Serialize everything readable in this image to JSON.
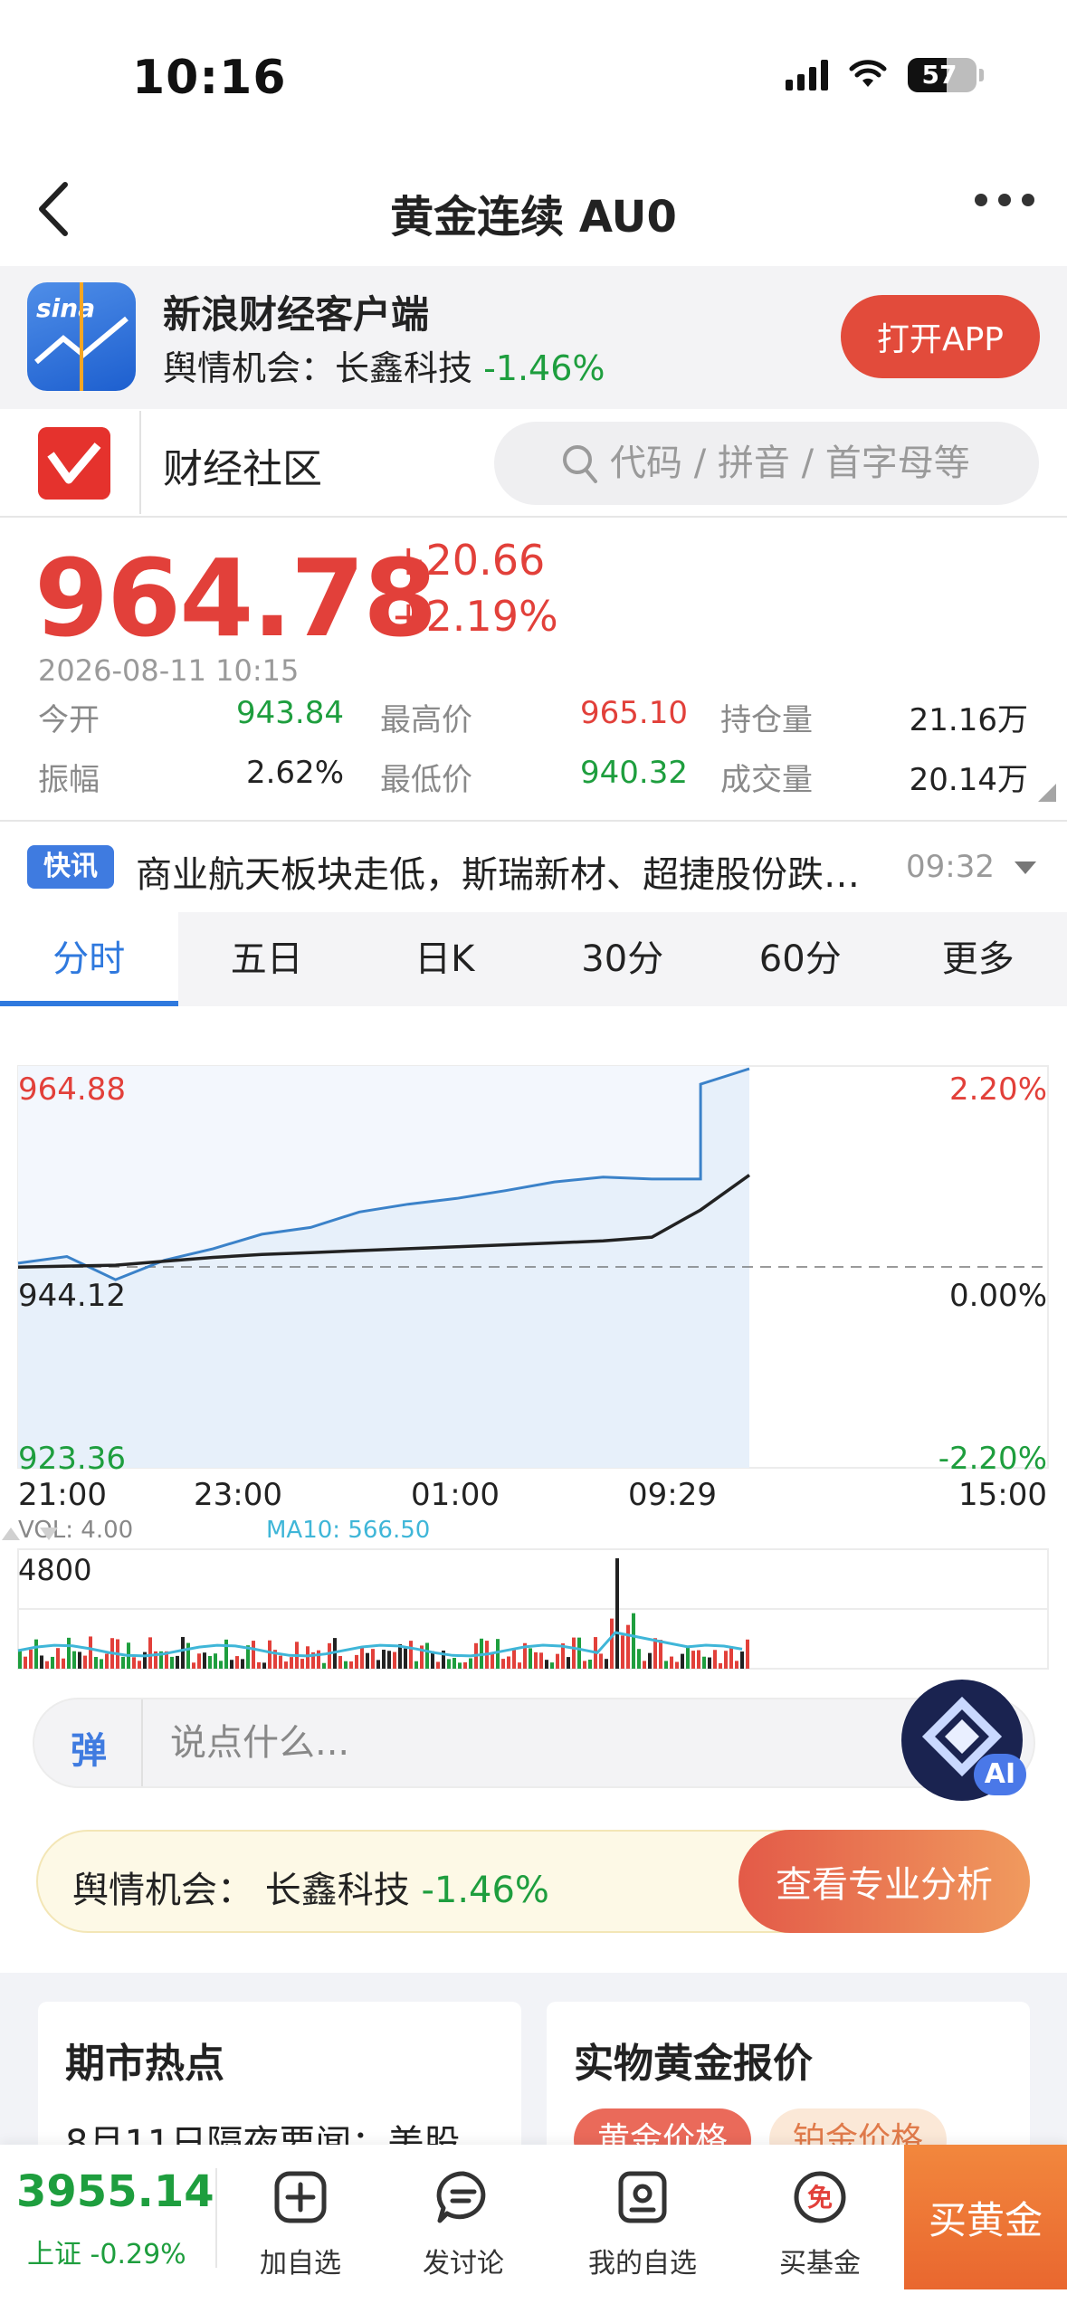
{
  "status_bar": {
    "time": "10:16",
    "battery": "57"
  },
  "nav": {
    "title": "黄金连续 AU0"
  },
  "banner": {
    "app_name": "新浪财经客户端",
    "logo_text": "sina",
    "sub_prefix": "舆情机会：长鑫科技 ",
    "sub_change": "-1.46%",
    "open_label": "打开APP"
  },
  "community": {
    "label": "财经社区",
    "search_placeholder": "代码 / 拼音 / 首字母等"
  },
  "quote": {
    "price": "964.78",
    "change": "+20.66",
    "change_pct": "+2.19%",
    "datetime": "2026-08-11  10:15",
    "stats": [
      {
        "key": "今开",
        "value": "943.84"
      },
      {
        "key": "最高价",
        "value": "965.10"
      },
      {
        "key": "持仓量",
        "value": "21.16万"
      },
      {
        "key": "振幅",
        "value": "2.62%"
      },
      {
        "key": "最低价",
        "value": "940.32"
      },
      {
        "key": "成交量",
        "value": "20.14万"
      }
    ]
  },
  "flash": {
    "badge": "快讯",
    "text": "商业航天板块走低，斯瑞新材、超捷股份跌…",
    "time": "09:32"
  },
  "tabs": [
    "分时",
    "五日",
    "日K",
    "30分",
    "60分",
    "更多"
  ],
  "chart": {
    "y_top": "964.88",
    "y_mid": "944.12",
    "y_bot": "923.36",
    "pct_top": "2.20%",
    "pct_mid": "0.00%",
    "pct_bot": "-2.20%",
    "times": [
      "21:00",
      "23:00",
      "01:00",
      "09:29",
      "15:00"
    ],
    "vol_label": "VOL: 4.00",
    "ma_label": "MA10: 566.50",
    "vol_max": "4800"
  },
  "chart_data": {
    "type": "line",
    "title": "",
    "xlabel": "",
    "ylabel": "",
    "ylim": [
      923.36,
      964.88
    ],
    "prev_close": 944.12,
    "x": [
      "21:00",
      "23:00",
      "01:00",
      "09:29",
      "15:00"
    ],
    "series": [
      {
        "values": [
          944.5,
          945.2,
          942.8,
          944.8,
          946.0,
          947.5,
          948.2,
          949.8,
          950.6,
          951.2,
          952.0,
          952.9,
          953.4,
          953.2,
          963.0,
          964.6
        ]
      },
      {
        "values": [
          944.1,
          944.2,
          944.3,
          944.7,
          945.1,
          945.4,
          945.6,
          945.8,
          946.0,
          946.2,
          946.4,
          946.6,
          946.8,
          947.2,
          950.0,
          953.6
        ]
      }
    ]
  },
  "comment": {
    "danmu_label": "弹",
    "placeholder": "说点什么...",
    "ai_label": "AI"
  },
  "opinion": {
    "prefix": "舆情机会：  长鑫科技 ",
    "change": "-1.46%",
    "button": "查看专业分析"
  },
  "cards": {
    "left_title": "期市热点",
    "left_line": "8月11日隔夜要闻：美股",
    "right_title": "实物黄金报价",
    "chips": [
      "黄金价格",
      "铂金价格"
    ]
  },
  "bottom": {
    "index_value": "3955.14",
    "index_sub": "上证 -0.29%",
    "items": [
      "加自选",
      "发讨论",
      "我的自选",
      "买基金"
    ],
    "free_badge": "免",
    "buy_label": "买黄金"
  },
  "colors": {
    "up": "#e2403a",
    "down": "#1e9e3e",
    "accent": "#2f79de"
  }
}
